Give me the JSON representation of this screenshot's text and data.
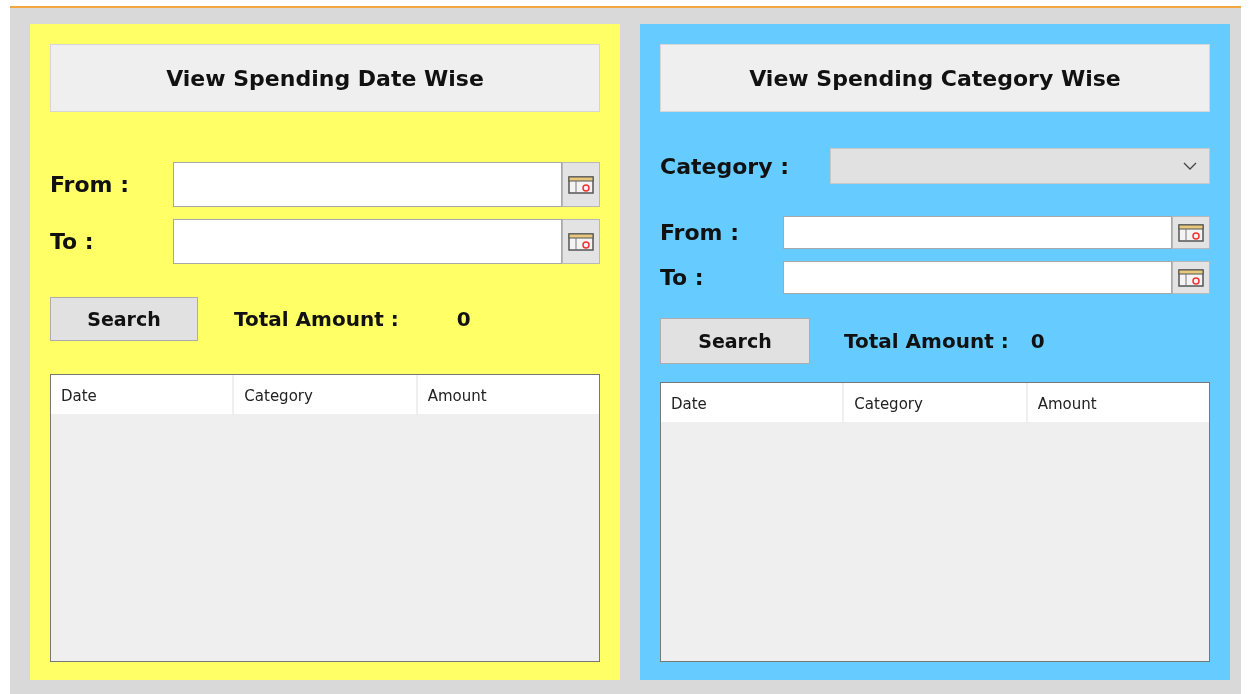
{
  "date_panel": {
    "title": "View Spending Date Wise",
    "date_fields": [
      {
        "label": "From :"
      },
      {
        "label": "To :"
      }
    ],
    "search_button": "Search",
    "total_label": "Total Amount :",
    "total_value": "0",
    "table": {
      "columns": [
        "Date",
        "Category",
        "Amount"
      ]
    }
  },
  "category_panel": {
    "title": "View Spending Category Wise",
    "category_label": "Category :",
    "date_fields": [
      {
        "label": "From :"
      },
      {
        "label": "To :"
      }
    ],
    "search_button": "Search",
    "total_label": "Total Amount :",
    "total_value": "0",
    "table": {
      "columns": [
        "Date",
        "Category",
        "Amount"
      ]
    }
  }
}
